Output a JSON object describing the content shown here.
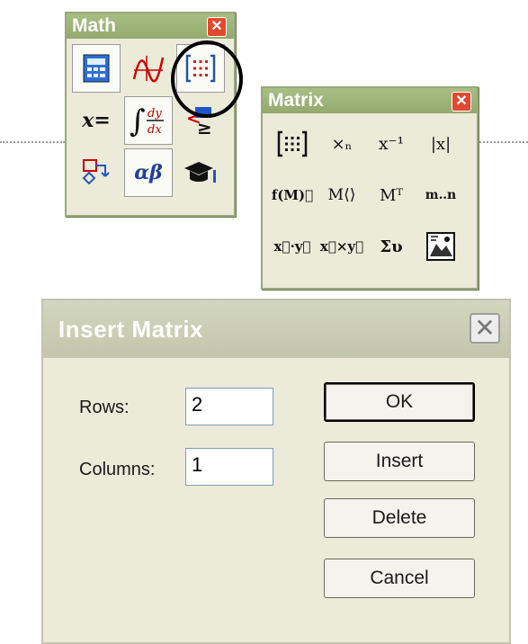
{
  "math_palette": {
    "title": "Math",
    "close_glyph": "✕",
    "buttons": [
      {
        "name": "calculator-toolbar-button",
        "icon": "calculator-icon",
        "glyph": "▦"
      },
      {
        "name": "graph-toolbar-button",
        "icon": "graph-icon",
        "glyph": "⁄⁄"
      },
      {
        "name": "matrix-toolbar-button",
        "icon": "matrix-icon",
        "glyph": "[⋮⋮]"
      },
      {
        "name": "evaluation-toolbar-button",
        "icon": "evaluation-icon",
        "glyph": "x="
      },
      {
        "name": "calculus-toolbar-button",
        "icon": "calculus-icon",
        "glyph": "∫dy/dx"
      },
      {
        "name": "boolean-toolbar-button",
        "icon": "boolean-icon",
        "glyph": "<≥"
      },
      {
        "name": "programming-toolbar-button",
        "icon": "programming-icon",
        "glyph": "⇄"
      },
      {
        "name": "greek-toolbar-button",
        "icon": "greek-icon",
        "glyph": "αβ"
      },
      {
        "name": "symbolic-toolbar-button",
        "icon": "symbolic-icon",
        "glyph": "🎓"
      }
    ]
  },
  "matrix_palette": {
    "title": "Matrix",
    "close_glyph": "✕",
    "buttons": [
      {
        "name": "insert-matrix-button",
        "icon": "matrix-grid-icon",
        "glyph": "[⋮⋮]"
      },
      {
        "name": "matrix-subscript-button",
        "icon": "subscript-icon",
        "glyph": "×ₙ"
      },
      {
        "name": "inverse-button",
        "icon": "inverse-icon",
        "glyph": "x⁻¹"
      },
      {
        "name": "determinant-button",
        "icon": "determinant-icon",
        "glyph": "|x|"
      },
      {
        "name": "vectorize-button",
        "icon": "vectorize-icon",
        "glyph": "f(M)⃗"
      },
      {
        "name": "matrix-column-button",
        "icon": "column-icon",
        "glyph": "M⟨⟩"
      },
      {
        "name": "transpose-button",
        "icon": "transpose-icon",
        "glyph": "Mᵀ"
      },
      {
        "name": "range-variable-button",
        "icon": "range-icon",
        "glyph": "m‥n"
      },
      {
        "name": "dot-product-button",
        "icon": "dot-product-icon",
        "glyph": "x⃗·y⃗"
      },
      {
        "name": "cross-product-button",
        "icon": "cross-product-icon",
        "glyph": "x⃗×y⃗"
      },
      {
        "name": "vector-sum-button",
        "icon": "vector-sum-icon",
        "glyph": "Συ"
      },
      {
        "name": "picture-button",
        "icon": "picture-icon",
        "glyph": "▣"
      }
    ]
  },
  "insert_matrix_dialog": {
    "title": "Insert Matrix",
    "close_glyph": "✕",
    "rows_label": "Rows:",
    "rows_value": "2",
    "columns_label": "Columns:",
    "columns_value": "1",
    "ok_label": "OK",
    "insert_label": "Insert",
    "delete_label": "Delete",
    "cancel_label": "Cancel"
  },
  "colors": {
    "palette_title": "#9cb27a",
    "close_red": "#e2492f",
    "highlight_circle": "#000000",
    "dialog_bg": "#ecead9"
  }
}
